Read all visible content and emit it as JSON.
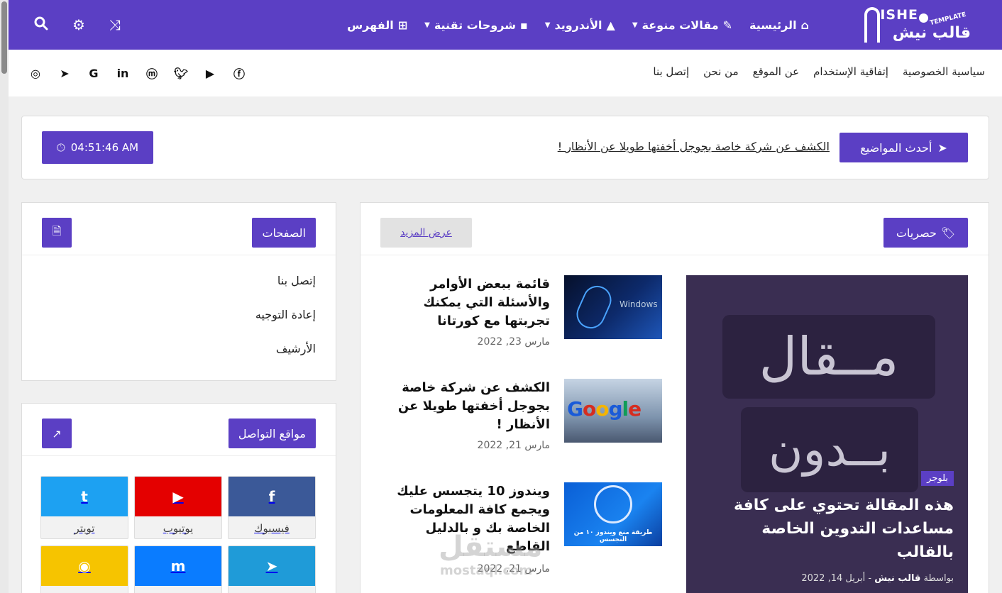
{
  "logo": {
    "en": "ISHE",
    "tpl": "TEMPLATE",
    "ar": "قالب نيش"
  },
  "menu": [
    {
      "label": "الرئيسية",
      "icon": "⌂",
      "chev": false
    },
    {
      "label": "مقالات منوعة",
      "icon": "✎",
      "chev": true
    },
    {
      "label": "الأندرويد",
      "icon": "▲",
      "chev": true
    },
    {
      "label": "شروحات تقنية",
      "icon": "▪",
      "chev": true
    },
    {
      "label": "الفهرس",
      "icon": "⊞",
      "chev": false
    }
  ],
  "sublinks": [
    "سياسية الخصوصية",
    "إتفاقية الإستخدام",
    "عن الموقع",
    "من نحن",
    "إتصل بنا"
  ],
  "ticker": {
    "latest_label": "أحدث المواضيع",
    "news": "الكشف عن شركة خاصة بجوجل أخفتها طويلا عن الأنظار !",
    "time": "04:51:46 AM"
  },
  "main": {
    "title": "حصريات",
    "more": "عرض المزيد",
    "featured": {
      "art1": "مــقال",
      "art2": "بــدون",
      "badge": "بلوجر",
      "title": "هذه المقالة تحتوي على كافة مساعدات التدوين الخاصة بالقالب",
      "by": "بواسطة",
      "author": "قالب نيش",
      "date": "أبريل 14, 2022"
    },
    "posts": [
      {
        "title": "قائمة ببعض الأوامر والأسئلة التي يمكنك تجربتها مع كورتانا",
        "date": "مارس 23, 2022",
        "thumb_text": "Windows"
      },
      {
        "title": "الكشف عن شركة خاصة بجوجل أخفتها طويلا عن الأنظار !",
        "date": "مارس 21, 2022",
        "thumb_text": "Google"
      },
      {
        "title": "ويندوز 10 يتجسس عليك ويجمع كافة المعلومات الخاصة بك و بالدليل القاطع",
        "date": "مارس 21, 2022",
        "thumb_text": "طريقة منع ويندوز ١٠ من التجسس"
      }
    ]
  },
  "pages_widget": {
    "title": "الصفحات",
    "items": [
      "إتصل بنا",
      "إعادة التوجيه",
      "الأرشيف"
    ]
  },
  "social_widget": {
    "title": "مواقع التواصل",
    "cards": [
      {
        "label": "فيسبوك",
        "glyph": "f",
        "color": "#3b5998"
      },
      {
        "label": "يوتيوب",
        "glyph": "▶",
        "color": "#e40000"
      },
      {
        "label": "تويتر",
        "glyph": "t",
        "color": "#1da1f2"
      },
      {
        "label": "",
        "glyph": "➤",
        "color": "#1f9bd8"
      },
      {
        "label": "",
        "glyph": "m",
        "color": "#0a7cff"
      },
      {
        "label": "",
        "glyph": "◉",
        "color": "#f6c400"
      }
    ]
  },
  "watermark": {
    "ar": "مستقل",
    "en": "mostaql.com"
  }
}
